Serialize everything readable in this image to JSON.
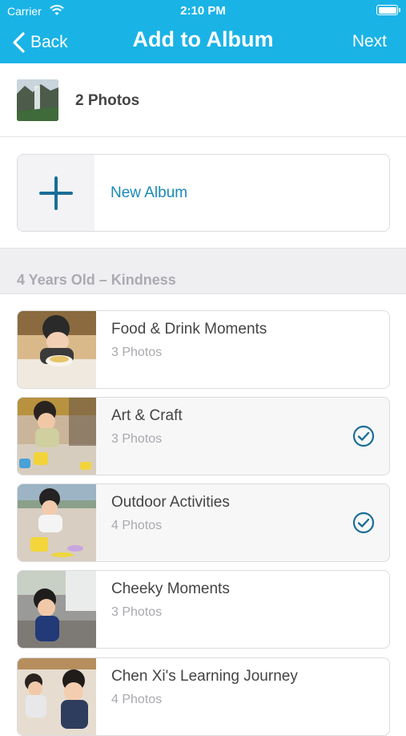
{
  "status": {
    "carrier": "Carrier",
    "time": "2:10 PM"
  },
  "nav": {
    "back_label": "Back",
    "title": "Add to Album",
    "next_label": "Next"
  },
  "selection": {
    "count_label": "2 Photos"
  },
  "new_album": {
    "label": "New Album"
  },
  "section": {
    "title": "4 Years Old – Kindness"
  },
  "albums": [
    {
      "name": "Food & Drink Moments",
      "count": "3 Photos",
      "checked": false
    },
    {
      "name": "Art & Craft",
      "count": "3 Photos",
      "checked": true
    },
    {
      "name": "Outdoor Activities",
      "count": "4 Photos",
      "checked": true
    },
    {
      "name": "Cheeky Moments",
      "count": "3 Photos",
      "checked": false
    },
    {
      "name": "Chen Xi's Learning Journey",
      "count": "4 Photos",
      "checked": false
    }
  ],
  "colors": {
    "header": "#1ab3e6",
    "accent": "#1a8ab8"
  },
  "icons": {
    "back": "chevron-left-icon",
    "wifi": "wifi-icon",
    "battery": "battery-icon",
    "add": "plus-icon",
    "check": "check-circle-icon"
  }
}
